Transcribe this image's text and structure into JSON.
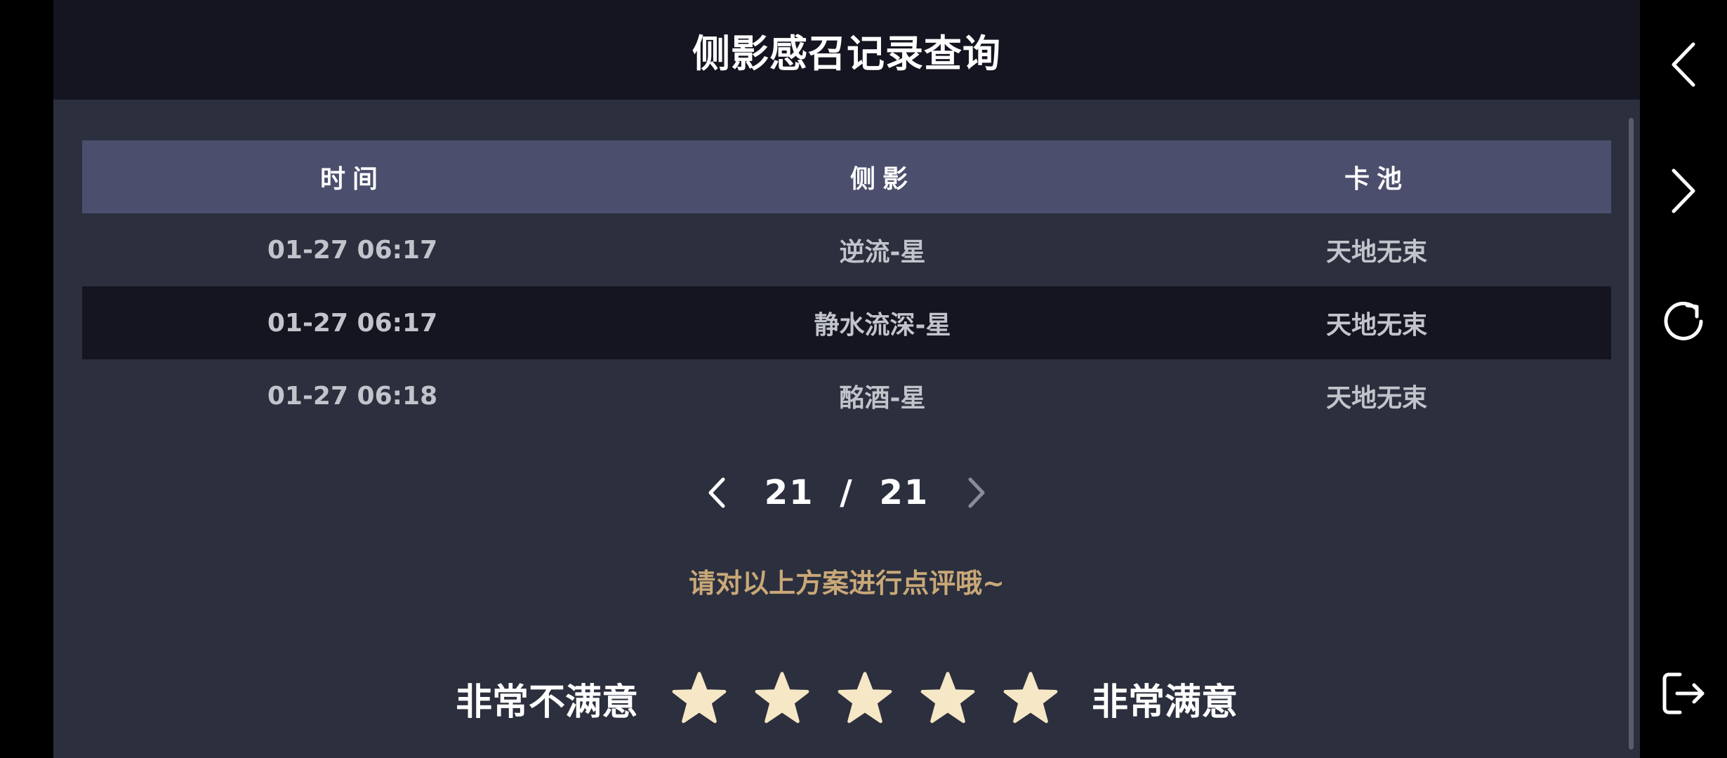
{
  "header": {
    "title": "侧影感召记录查询"
  },
  "table": {
    "columns": [
      "时间",
      "侧影",
      "卡池"
    ],
    "rows": [
      [
        "01-27 06:17",
        "逆流-星",
        "天地无束"
      ],
      [
        "01-27 06:17",
        "静水流深-星",
        "天地无束"
      ],
      [
        "01-27 06:18",
        "酩酒-星",
        "天地无束"
      ]
    ]
  },
  "pager": {
    "current": "21",
    "separator": "/",
    "total": "21"
  },
  "prompt": "请对以上方案进行点评哦~",
  "rating": {
    "left_label": "非常不满意",
    "right_label": "非常满意",
    "star_count": 5,
    "star_color": "#f6e7c6"
  },
  "side_icons": [
    "chevron-left-icon",
    "chevron-right-icon",
    "refresh-icon",
    "exit-icon"
  ],
  "colors": {
    "panel_bg": "#2c2f3d",
    "header_bg": "#141520",
    "table_header_bg": "#4b4e6c",
    "accent_text": "#c9a878"
  }
}
